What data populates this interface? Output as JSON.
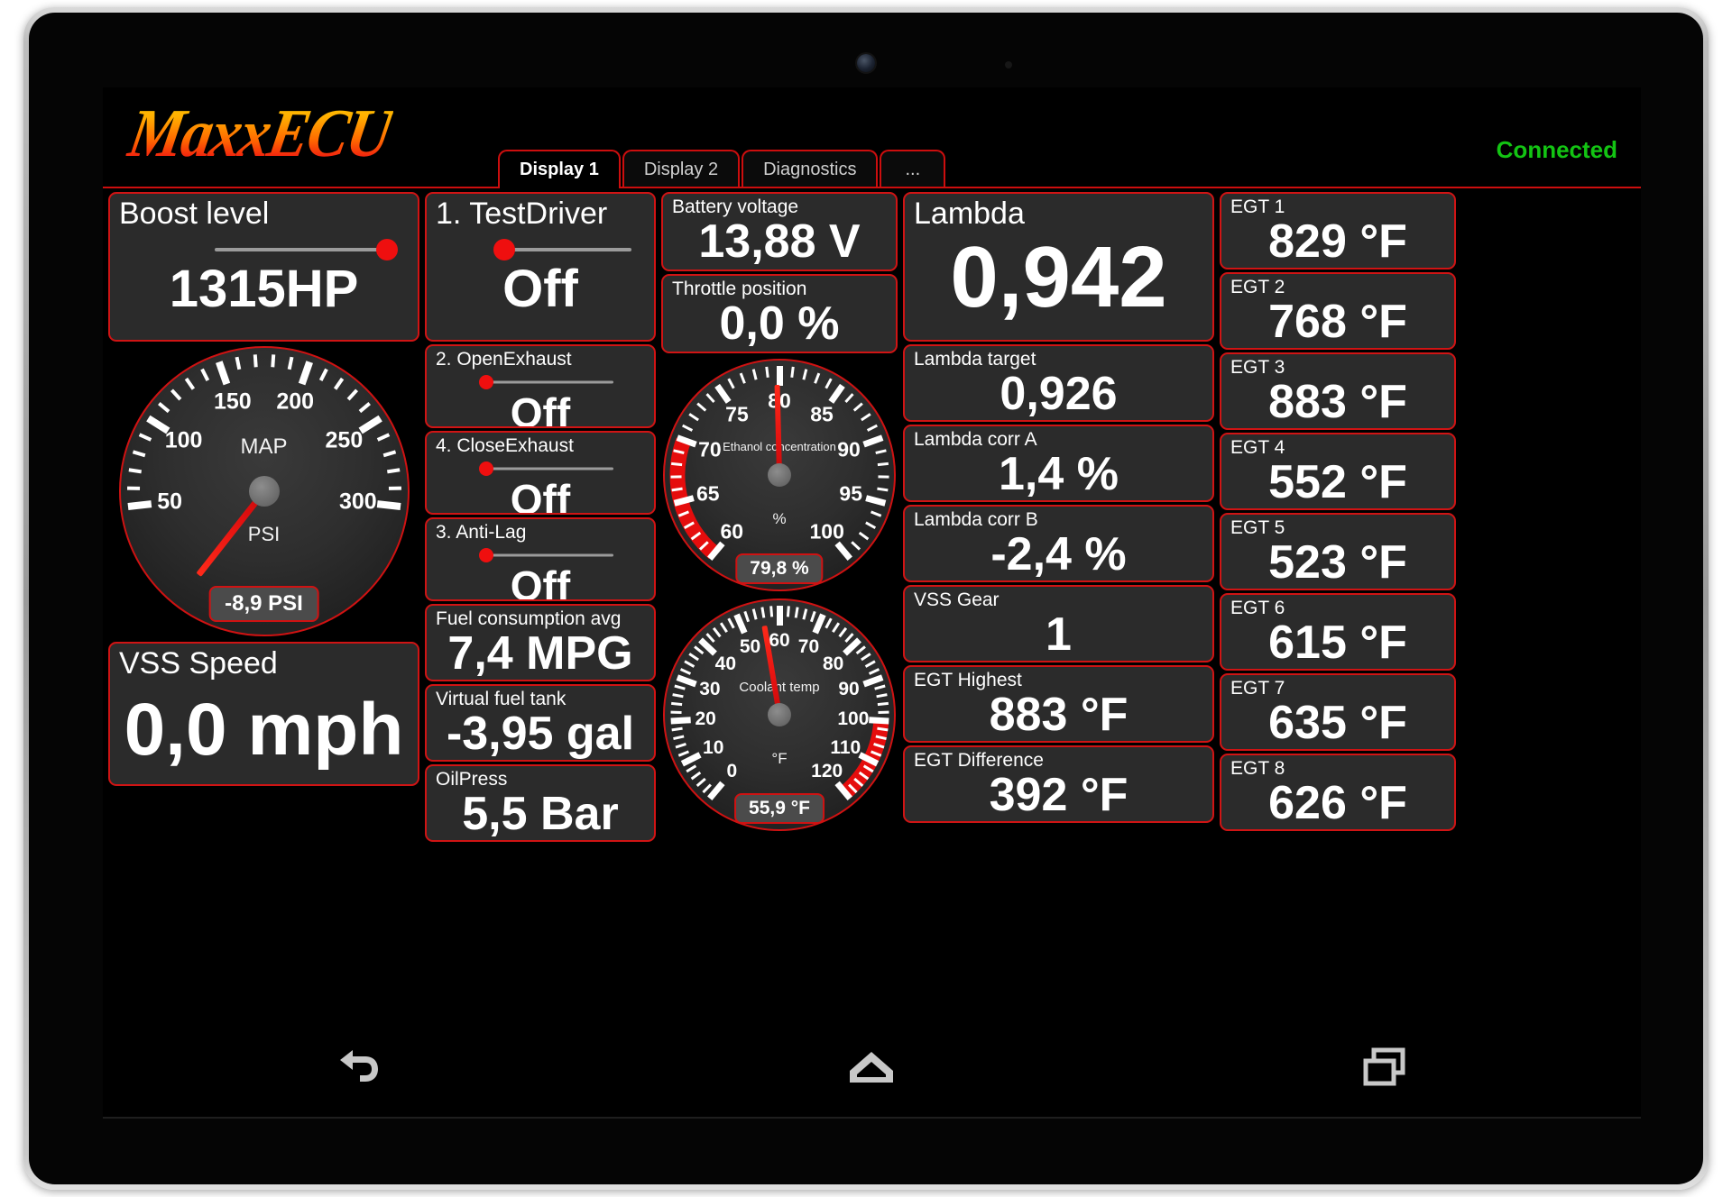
{
  "header": {
    "brand": "MaxxECU",
    "status": "Connected",
    "status_color": "#13c413",
    "tabs": [
      {
        "label": "Display 1",
        "active": true
      },
      {
        "label": "Display 2",
        "active": false
      },
      {
        "label": "Diagnostics",
        "active": false
      },
      {
        "label": "...",
        "active": false
      }
    ]
  },
  "accent": {
    "border": "#d01414",
    "tile_bg": "#2b2b2b",
    "knob": "#ef0f0f"
  },
  "left_column": {
    "boost": {
      "label": "Boost level",
      "value": "1315HP",
      "slider_position": "right"
    },
    "map_gauge": {
      "name": "MAP",
      "unit": "PSI",
      "badge": "-8,9 PSI",
      "labels": [
        "50",
        "100",
        "150",
        "200",
        "250",
        "300"
      ],
      "min": 0,
      "max": 350,
      "value": -8.9
    },
    "vss_speed": {
      "label": "VSS Speed",
      "value": "0,0 mph"
    }
  },
  "switch_column": {
    "testdriver": {
      "label": "1. TestDriver",
      "value": "Off",
      "slider_position": "left"
    },
    "switches": [
      {
        "label": "2. OpenExhaust",
        "value": "Off",
        "slider_position": "left"
      },
      {
        "label": "4. CloseExhaust",
        "value": "Off",
        "slider_position": "left"
      },
      {
        "label": "3. Anti-Lag",
        "value": "Off",
        "slider_position": "left"
      }
    ],
    "fuel_consumption": {
      "label": "Fuel consumption avg",
      "value": "7,4 MPG"
    },
    "virtual_fuel_tank": {
      "label": "Virtual fuel tank",
      "value": "-3,95 gal"
    },
    "oil_press": {
      "label": "OilPress",
      "value": "5,5 Bar"
    }
  },
  "mid_column": {
    "battery": {
      "label": "Battery voltage",
      "value": "13,88 V"
    },
    "throttle": {
      "label": "Throttle position",
      "value": "0,0 %"
    },
    "ethanol_gauge": {
      "name": "Ethanol concentration",
      "unit": "%",
      "badge": "79,8 %",
      "labels": [
        "60",
        "65",
        "70",
        "75",
        "80",
        "85",
        "90",
        "95",
        "100"
      ],
      "min": 60,
      "max": 100,
      "value": 79.8,
      "warn_zone": {
        "from": 60,
        "to": 70,
        "color": "#e50d0d"
      }
    },
    "coolant_gauge": {
      "name": "Coolant temp",
      "unit": "°F",
      "badge": "55,9 °F",
      "labels": [
        "0",
        "10",
        "20",
        "30",
        "40",
        "50",
        "60",
        "70",
        "80",
        "90",
        "100",
        "110",
        "120"
      ],
      "min": 0,
      "max": 120,
      "value": 55.9,
      "warn_zone": {
        "from": 100,
        "to": 120,
        "color": "#e50d0d"
      }
    }
  },
  "lambda_column": {
    "lambda": {
      "label": "Lambda",
      "value": "0,942"
    },
    "rows": [
      {
        "label": "Lambda target",
        "value": "0,926"
      },
      {
        "label": "Lambda corr A",
        "value": "1,4 %"
      },
      {
        "label": "Lambda corr B",
        "value": "-2,4 %"
      },
      {
        "label": "VSS Gear",
        "value": "1"
      },
      {
        "label": "EGT Highest",
        "value": "883 °F"
      },
      {
        "label": "EGT Difference",
        "value": "392 °F"
      }
    ]
  },
  "egt_column": {
    "rows": [
      {
        "label": "EGT 1",
        "value": "829 °F"
      },
      {
        "label": "EGT 2",
        "value": "768 °F"
      },
      {
        "label": "EGT 3",
        "value": "883 °F"
      },
      {
        "label": "EGT 4",
        "value": "552 °F"
      },
      {
        "label": "EGT 5",
        "value": "523 °F"
      },
      {
        "label": "EGT 6",
        "value": "615 °F"
      },
      {
        "label": "EGT 7",
        "value": "635 °F"
      },
      {
        "label": "EGT 8",
        "value": "626 °F"
      }
    ]
  },
  "navbar": {
    "back": "back-icon",
    "home": "home-icon",
    "recents": "recents-icon"
  }
}
